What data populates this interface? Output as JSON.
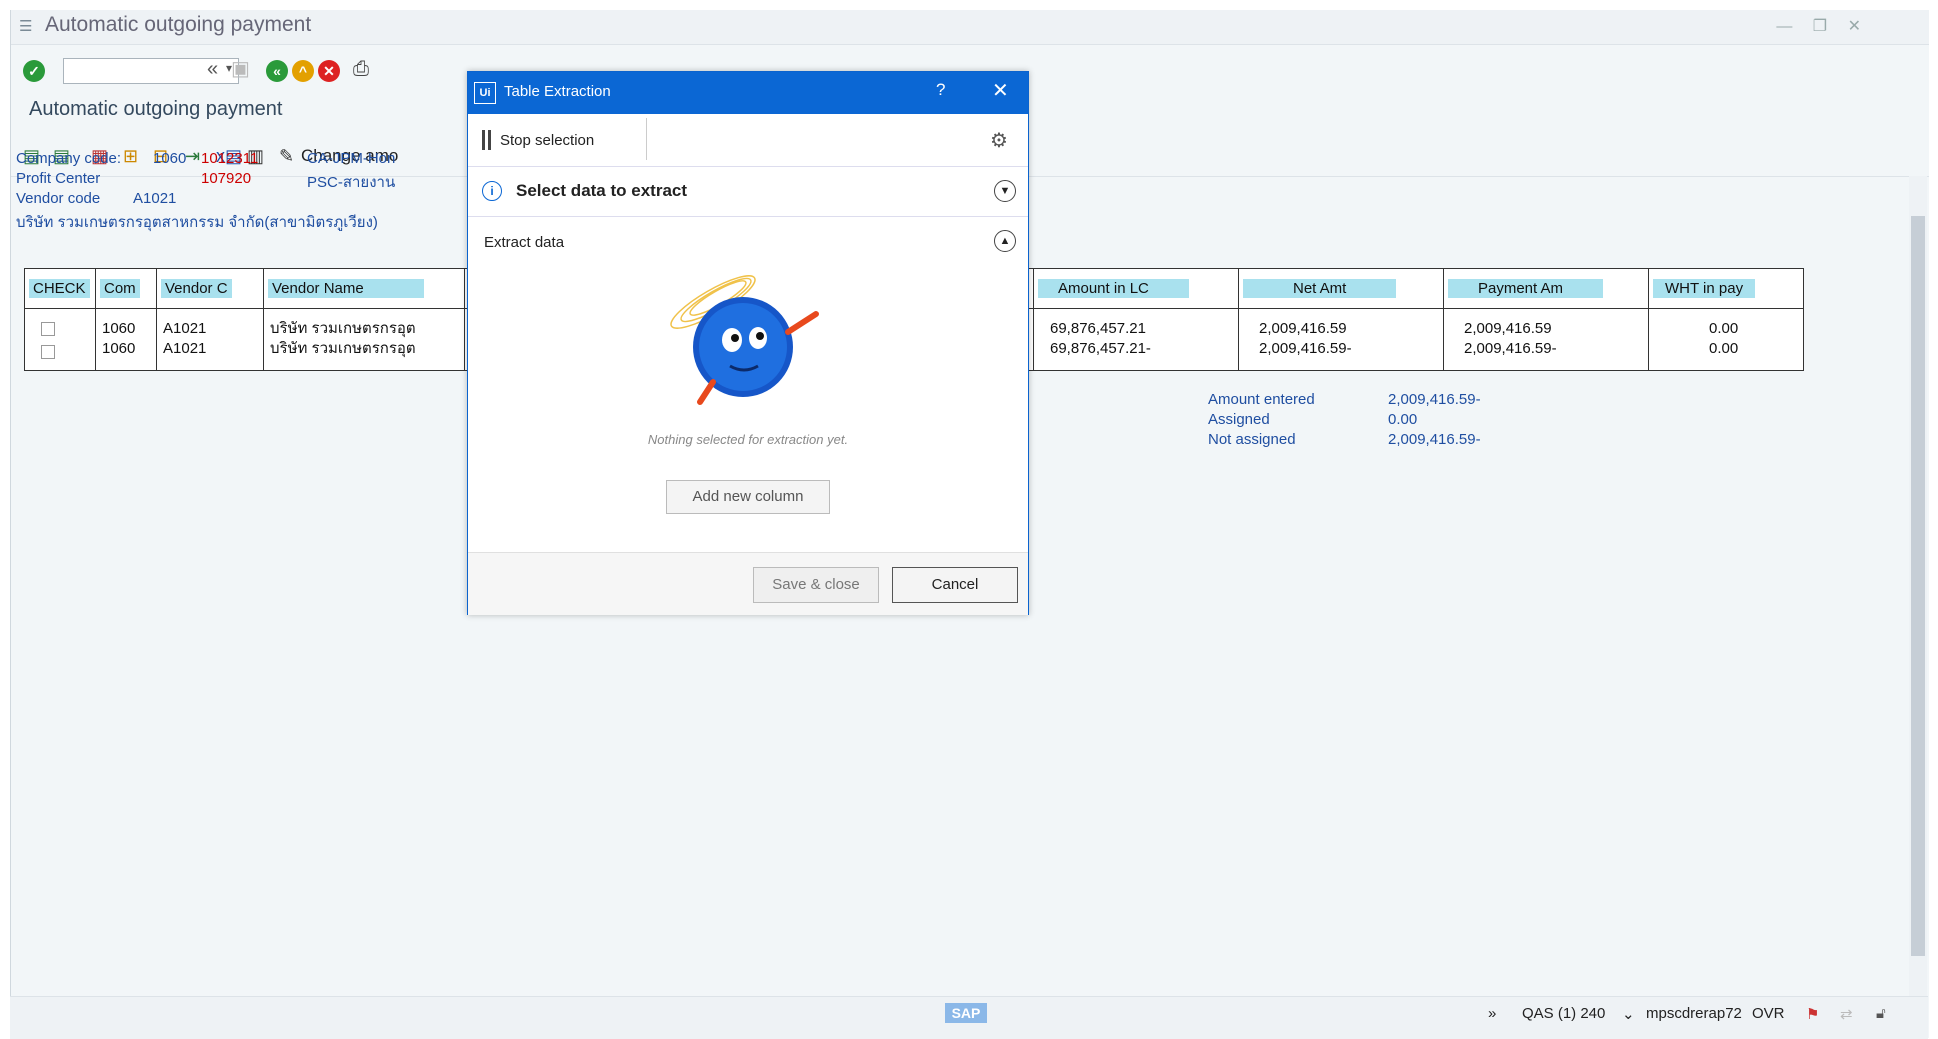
{
  "window": {
    "title": "Automatic outgoing payment"
  },
  "screen_title": "Automatic outgoing payment",
  "app_toolbar": {
    "change_label": "Change amo"
  },
  "info": {
    "company_code_label": "Company code:",
    "company_code": "1060",
    "company_code_ref": "1012311",
    "company_desc": "CA-JPM-Hon",
    "profit_center_label": "Profit Center",
    "profit_center": "107920",
    "profit_desc": "PSC-สายงาน",
    "vendor_code_label": "Vendor code",
    "vendor_code": "A1021",
    "vendor_full_name": "บริษัท รวมเกษตรกรอุตสาหกรรม จำกัด(สาขามิตรภูเวียง)"
  },
  "table": {
    "headers": [
      "CHECK",
      "Com",
      "Vendor C",
      "Vendor Name",
      "Amount in LC",
      "Net Amt",
      "Payment Am",
      "WHT in pay"
    ],
    "rows": [
      {
        "com": "1060",
        "vendor": "A1021",
        "name": "บริษัท รวมเกษตรกรอุต",
        "amount_lc": "69,876,457.21",
        "net": "2,009,416.59",
        "payment": "2,009,416.59",
        "wht": "0.00"
      },
      {
        "com": "1060",
        "vendor": "A1021",
        "name": "บริษัท รวมเกษตรกรอุต",
        "amount_lc": "69,876,457.21-",
        "net": "2,009,416.59-",
        "payment": "2,009,416.59-",
        "wht": "0.00"
      }
    ]
  },
  "totals": {
    "amount_entered_label": "Amount entered",
    "amount_entered": "2,009,416.59-",
    "assigned_label": "Assigned",
    "assigned": "0.00",
    "not_assigned_label": "Not assigned",
    "not_assigned": "2,009,416.59-"
  },
  "dialog": {
    "logo": "Ui",
    "title": "Table Extraction",
    "help": "?",
    "stop_label": "Stop selection",
    "section1_title": "Select data to extract",
    "section2_title": "Extract data",
    "empty_message": "Nothing selected for extraction yet.",
    "add_column": "Add new column",
    "save_close": "Save & close",
    "cancel": "Cancel"
  },
  "status": {
    "logo": "SAP",
    "system": "QAS (1) 240",
    "server": "mpscdrerap72",
    "mode": "OVR"
  },
  "colors": {
    "accent": "#0b67d4",
    "header_cell": "#a9e1ee",
    "info_text": "#1f4ea1"
  }
}
